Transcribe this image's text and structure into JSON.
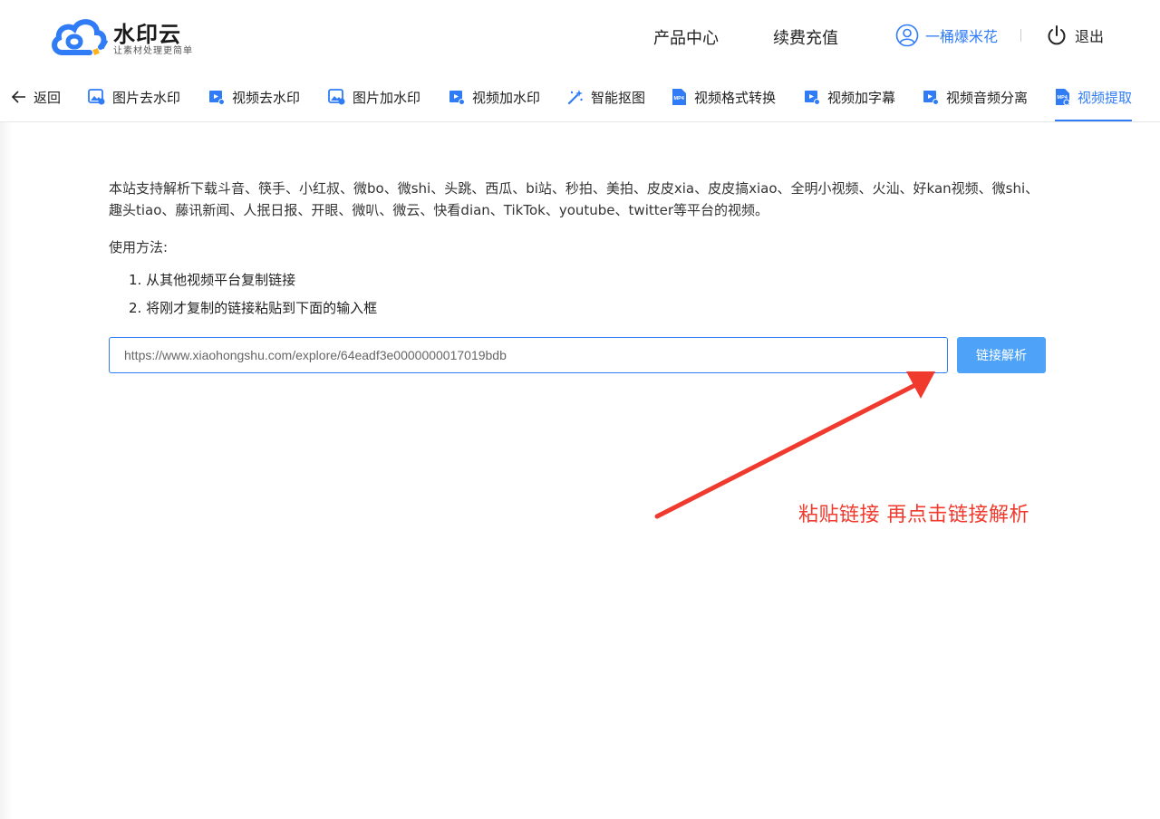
{
  "header": {
    "logo_title": "水印云",
    "logo_tagline": "让素材处理更简单",
    "nav": [
      "产品中心",
      "续费充值"
    ],
    "user_name": "一桶爆米花",
    "logout_label": "退出"
  },
  "tabs": {
    "back_label": "返回",
    "items": [
      {
        "label": "图片去水印",
        "icon": "image-remove-icon"
      },
      {
        "label": "视频去水印",
        "icon": "video-remove-icon"
      },
      {
        "label": "图片加水印",
        "icon": "image-add-icon"
      },
      {
        "label": "视频加水印",
        "icon": "video-add-icon"
      },
      {
        "label": "智能抠图",
        "icon": "magic-wand-icon"
      },
      {
        "label": "视频格式转换",
        "icon": "mp4-icon"
      },
      {
        "label": "视频加字幕",
        "icon": "video-subtitle-icon"
      },
      {
        "label": "视频音频分离",
        "icon": "video-audio-icon"
      },
      {
        "label": "视频提取",
        "icon": "mp4-extract-icon",
        "active": true
      }
    ]
  },
  "main": {
    "description": "本站支持解析下载斗音、筷手、小红叔、微bo、微shi、头跳、西瓜、bi站、秒拍、美拍、皮皮xia、皮皮搞xiao、全明小视频、火汕、好kan视频、微shi、趣头tiao、藤讯新闻、人抿日报、开眼、微叭、微云、快看dian、TikTok、youtube、twitter等平台的视频。",
    "usage_title": "使用方法:",
    "steps": [
      "1. 从其他视频平台复制链接",
      "2. 将刚才复制的链接粘贴到下面的输入框"
    ],
    "url_value": "https://www.xiaohongshu.com/explore/64eadf3e0000000017019bdb",
    "parse_button": "链接解析",
    "annotation": "粘贴链接 再点击链接解析"
  },
  "colors": {
    "accent": "#2f7cf6",
    "button": "#4ea3f8",
    "annotation": "#f03a2e"
  }
}
